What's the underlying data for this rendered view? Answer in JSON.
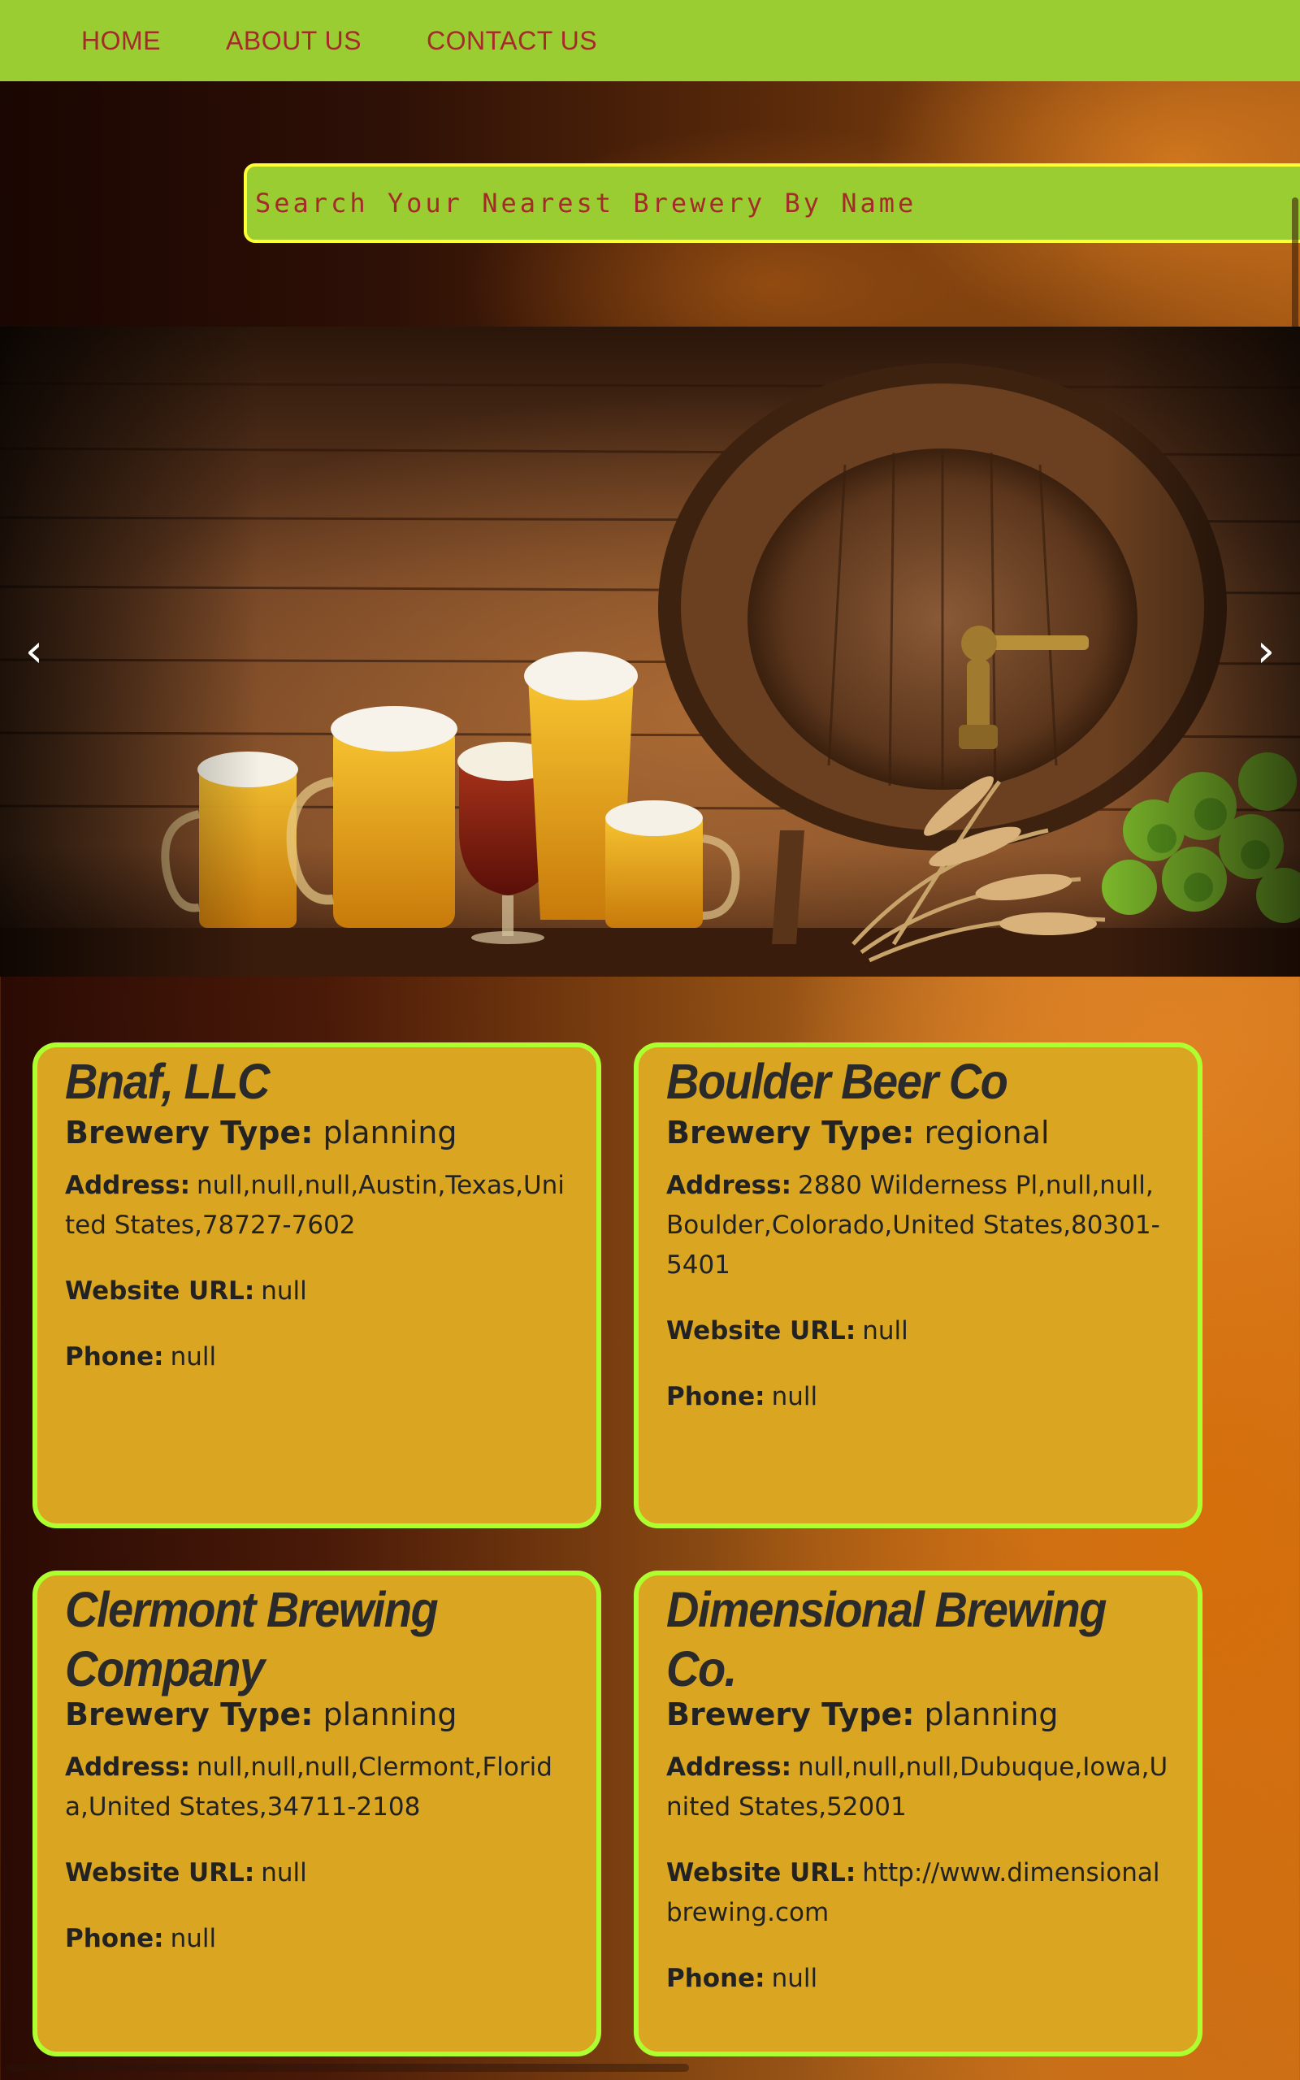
{
  "nav": {
    "items": [
      "HOME",
      "ABOUT US",
      "CONTACT US"
    ]
  },
  "search": {
    "placeholder": "Search Your Nearest Brewery By Name",
    "value": ""
  },
  "carousel": {
    "prev_label": "‹",
    "next_label": "›"
  },
  "labels": {
    "brewery_type": "Brewery Type:",
    "address": "Address:",
    "website": "Website URL:",
    "phone": "Phone:"
  },
  "breweries": [
    {
      "name": "Bnaf, LLC",
      "type": "planning",
      "address": "null,null,null,Austin,Texas,United States,78727-7602",
      "website": "null",
      "phone": "null"
    },
    {
      "name": "Boulder Beer Co",
      "type": "regional",
      "address": "2880 Wilderness Pl,null,null,Boulder,Colorado,United States,80301-5401",
      "website": "null",
      "phone": "null"
    },
    {
      "name": "Clermont Brewing Company",
      "type": "planning",
      "address": "null,null,null,Clermont,Florida,United States,34711-2108",
      "website": "null",
      "phone": "null"
    },
    {
      "name": "Dimensional Brewing Co.",
      "type": "planning",
      "address": "null,null,null,Dubuque,Iowa,United States,52001",
      "website": "http://www.dimensionalbrewing.com",
      "phone": "null"
    }
  ],
  "colors": {
    "nav_bg": "#9acd32",
    "nav_text": "#a52a2a",
    "card_bg": "#daa520",
    "card_border": "#adff2f",
    "search_border": "#ffff33"
  }
}
